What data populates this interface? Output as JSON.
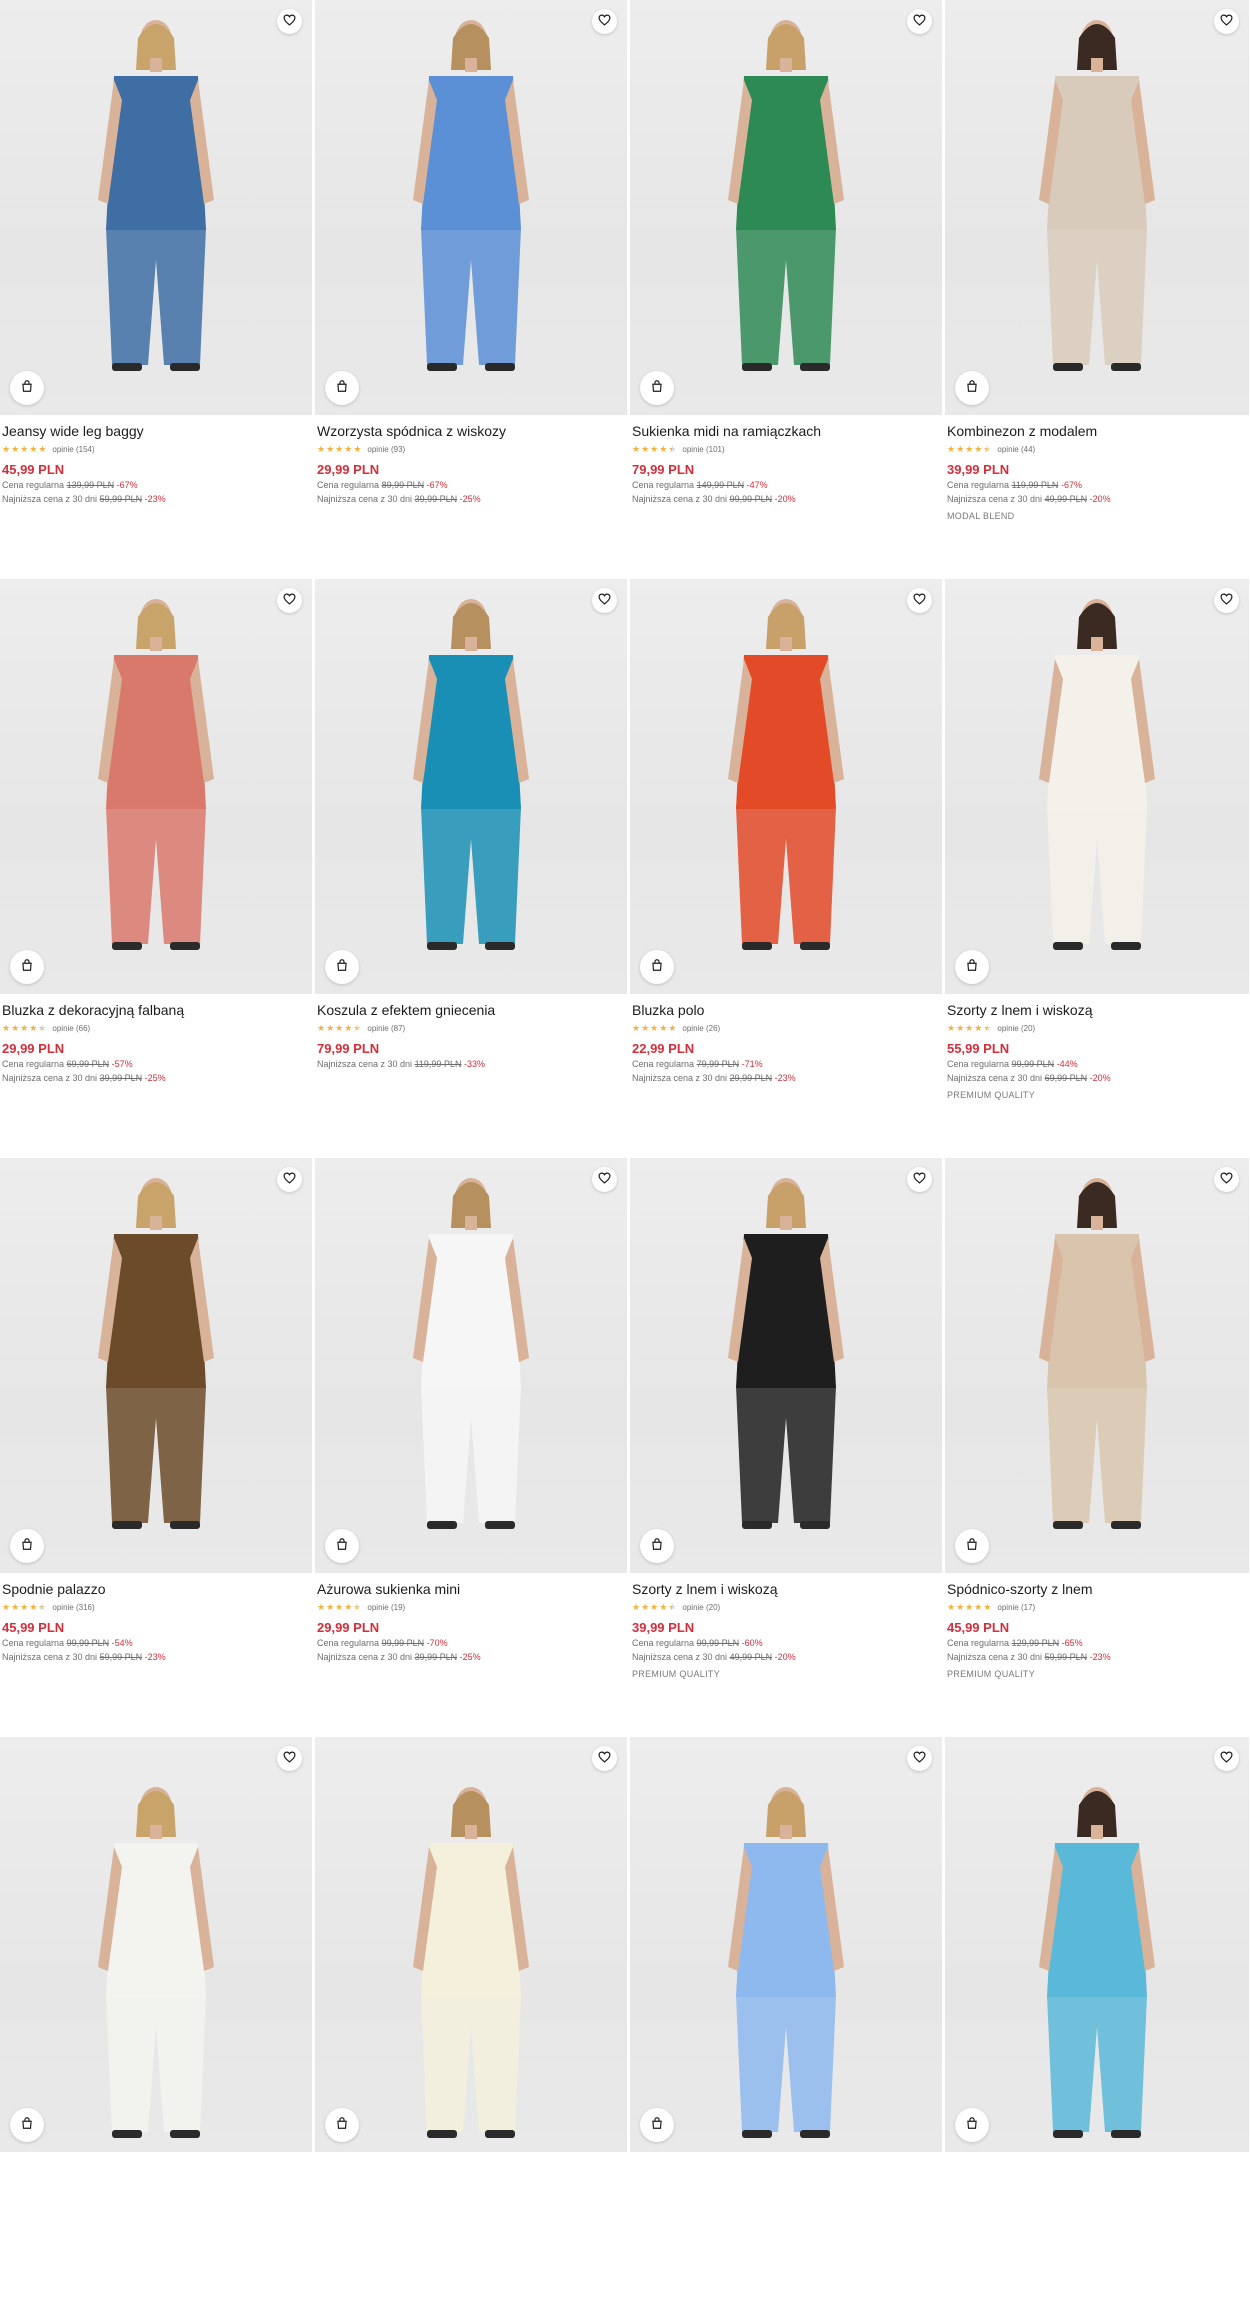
{
  "products": [
    {
      "name": "Jeansy wide leg baggy",
      "reviews": "opinie (154)",
      "stars": 5,
      "price": "45,99 PLN",
      "regular_label": "Cena regularna",
      "regular_price": "139,99 PLN",
      "regular_disc": "-67%",
      "lowest_label": "Najniższa cena z 30 dni",
      "lowest_price": "59,99 PLN",
      "lowest_disc": "-23%",
      "badge": ""
    },
    {
      "name": "Wzorzysta spódnica z wiskozy",
      "reviews": "opinie (93)",
      "stars": 5,
      "price": "29,99 PLN",
      "regular_label": "Cena regularna",
      "regular_price": "89,99 PLN",
      "regular_disc": "-67%",
      "lowest_label": "Najniższa cena z 30 dni",
      "lowest_price": "39,99 PLN",
      "lowest_disc": "-25%",
      "badge": ""
    },
    {
      "name": "Sukienka midi na ramiączkach",
      "reviews": "opinie (101)",
      "stars": 4.5,
      "price": "79,99 PLN",
      "regular_label": "Cena regularna",
      "regular_price": "149,99 PLN",
      "regular_disc": "-47%",
      "lowest_label": "Najniższa cena z 30 dni",
      "lowest_price": "99,99 PLN",
      "lowest_disc": "-20%",
      "badge": ""
    },
    {
      "name": "Kombinezon z modalem",
      "reviews": "opinie (44)",
      "stars": 4.5,
      "price": "39,99 PLN",
      "regular_label": "Cena regularna",
      "regular_price": "119,99 PLN",
      "regular_disc": "-67%",
      "lowest_label": "Najniższa cena z 30 dni",
      "lowest_price": "49,99 PLN",
      "lowest_disc": "-20%",
      "badge": "MODAL BLEND"
    },
    {
      "name": "Bluzka z dekoracyjną falbaną",
      "reviews": "opinie (66)",
      "stars": 4.5,
      "price": "29,99 PLN",
      "regular_label": "Cena regularna",
      "regular_price": "69,99 PLN",
      "regular_disc": "-57%",
      "lowest_label": "Najniższa cena z 30 dni",
      "lowest_price": "39,99 PLN",
      "lowest_disc": "-25%",
      "badge": ""
    },
    {
      "name": "Koszula z efektem gniecenia",
      "reviews": "opinie (87)",
      "stars": 4.5,
      "price": "79,99 PLN",
      "regular_label": "",
      "regular_price": "",
      "regular_disc": "",
      "lowest_label": "Najniższa cena z 30 dni",
      "lowest_price": "119,99 PLN",
      "lowest_disc": "-33%",
      "badge": ""
    },
    {
      "name": "Bluzka polo",
      "reviews": "opinie (26)",
      "stars": 5,
      "price": "22,99 PLN",
      "regular_label": "Cena regularna",
      "regular_price": "79,99 PLN",
      "regular_disc": "-71%",
      "lowest_label": "Najniższa cena z 30 dni",
      "lowest_price": "29,99 PLN",
      "lowest_disc": "-23%",
      "badge": ""
    },
    {
      "name": "Szorty z lnem i wiskozą",
      "reviews": "opinie (20)",
      "stars": 4.5,
      "price": "55,99 PLN",
      "regular_label": "Cena regularna",
      "regular_price": "99,99 PLN",
      "regular_disc": "-44%",
      "lowest_label": "Najniższa cena z 30 dni",
      "lowest_price": "69,99 PLN",
      "lowest_disc": "-20%",
      "badge": "PREMIUM QUALITY"
    },
    {
      "name": "Spodnie palazzo",
      "reviews": "opinie (316)",
      "stars": 4.5,
      "price": "45,99 PLN",
      "regular_label": "Cena regularna",
      "regular_price": "99,99 PLN",
      "regular_disc": "-54%",
      "lowest_label": "Najniższa cena z 30 dni",
      "lowest_price": "59,99 PLN",
      "lowest_disc": "-23%",
      "badge": ""
    },
    {
      "name": "Ażurowa sukienka mini",
      "reviews": "opinie (19)",
      "stars": 4.5,
      "price": "29,99 PLN",
      "regular_label": "Cena regularna",
      "regular_price": "99,99 PLN",
      "regular_disc": "-70%",
      "lowest_label": "Najniższa cena z 30 dni",
      "lowest_price": "39,99 PLN",
      "lowest_disc": "-25%",
      "badge": ""
    },
    {
      "name": "Szorty z lnem i wiskozą",
      "reviews": "opinie (20)",
      "stars": 4.5,
      "price": "39,99 PLN",
      "regular_label": "Cena regularna",
      "regular_price": "99,99 PLN",
      "regular_disc": "-60%",
      "lowest_label": "Najniższa cena z 30 dni",
      "lowest_price": "49,99 PLN",
      "lowest_disc": "-20%",
      "badge": "PREMIUM QUALITY"
    },
    {
      "name": "Spódnico-szorty z lnem",
      "reviews": "opinie (17)",
      "stars": 5,
      "price": "45,99 PLN",
      "regular_label": "Cena regularna",
      "regular_price": "129,99 PLN",
      "regular_disc": "-65%",
      "lowest_label": "Najniższa cena z 30 dni",
      "lowest_price": "59,99 PLN",
      "lowest_disc": "-23%",
      "badge": "PREMIUM QUALITY"
    },
    {
      "name": "",
      "reviews": "",
      "stars": 0,
      "price": "",
      "regular_label": "",
      "regular_price": "",
      "regular_disc": "",
      "lowest_label": "",
      "lowest_price": "",
      "lowest_disc": "",
      "badge": ""
    },
    {
      "name": "",
      "reviews": "",
      "stars": 0,
      "price": "",
      "regular_label": "",
      "regular_price": "",
      "regular_disc": "",
      "lowest_label": "",
      "lowest_price": "",
      "lowest_disc": "",
      "badge": ""
    },
    {
      "name": "",
      "reviews": "",
      "stars": 0,
      "price": "",
      "regular_label": "",
      "regular_price": "",
      "regular_disc": "",
      "lowest_label": "",
      "lowest_price": "",
      "lowest_disc": "",
      "badge": ""
    },
    {
      "name": "",
      "reviews": "",
      "stars": 0,
      "price": "",
      "regular_label": "",
      "regular_price": "",
      "regular_disc": "",
      "lowest_label": "",
      "lowest_price": "",
      "lowest_disc": "",
      "badge": ""
    }
  ],
  "colors": {
    "price": "#d42e3b",
    "star": "#f2b141",
    "garments": [
      "#3f6ea5",
      "#5b8fd6",
      "#2e8a55",
      "#d8cbbb",
      "#d9796c",
      "#1a8fb5",
      "#e24a28",
      "#f4f1ea",
      "#6b4b2a",
      "#f6f6f6",
      "#1e1e1e",
      "#d9c5ad",
      "#f3f3f0",
      "#f5f0dc",
      "#8db9ef",
      "#5ab8d9"
    ]
  },
  "icons": {
    "favorite": "heart-icon",
    "add_to_bag": "shopping-bag-icon"
  }
}
